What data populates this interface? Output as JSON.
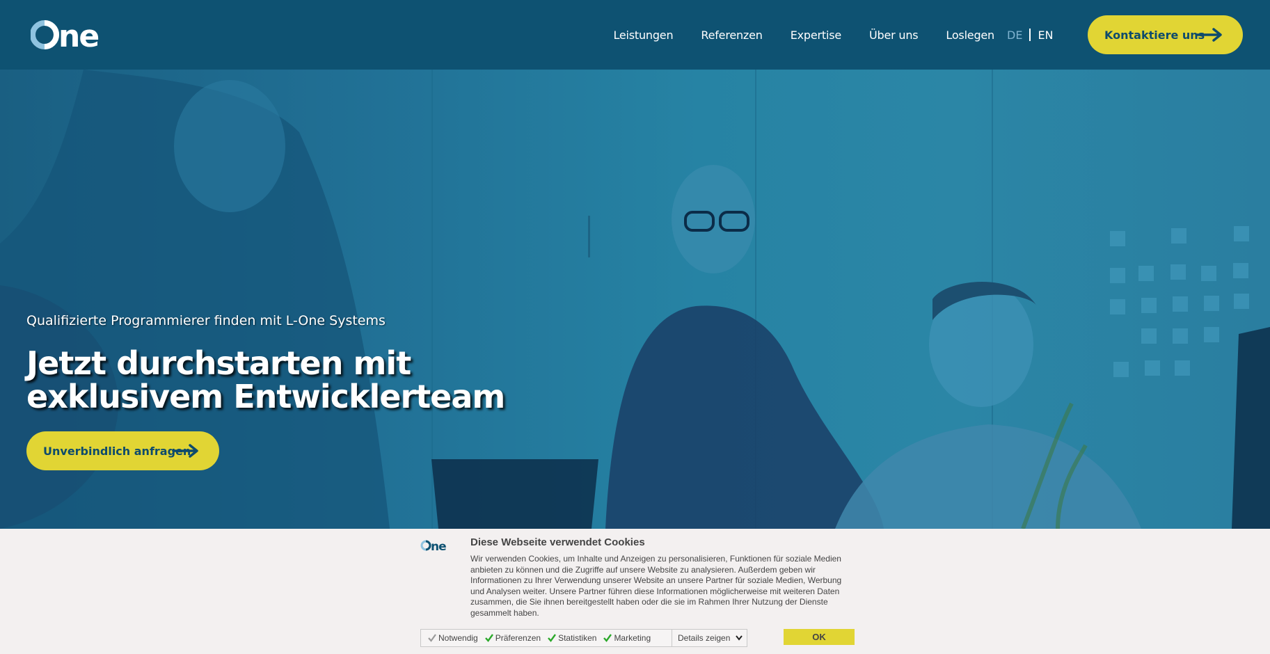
{
  "header": {
    "logo_text": "one",
    "nav": [
      "Leistungen",
      "Referenzen",
      "Expertise",
      "Über uns",
      "Loslegen"
    ],
    "lang_de": "DE",
    "lang_en": "EN",
    "contact_label": "Kontaktiere uns"
  },
  "hero": {
    "subtitle": "Qualifizierte Programmierer finden mit L-One Systems",
    "title_line1": "Jetzt durchstarten mit",
    "title_line2": "exklusivem Entwicklerteam",
    "cta_label": "Unverbindlich anfragen"
  },
  "cookie": {
    "logo_text": "one",
    "title": "Diese Webseite verwendet Cookies",
    "text": "Wir verwenden Cookies, um Inhalte und Anzeigen zu personalisieren, Funktionen für soziale Medien anbieten zu können und die Zugriffe auf unsere Website zu analysieren. Außerdem geben wir Informationen zu Ihrer Verwendung unserer Website an unsere Partner für soziale Medien, Werbung und Analysen weiter. Unsere Partner führen diese Informationen möglicherweise mit weiteren Daten zusammen, die Sie ihnen bereitgestellt haben oder die sie im Rahmen Ihrer Nutzung der Dienste gesammelt haben.",
    "options": [
      "Notwendig",
      "Präferenzen",
      "Statistiken",
      "Marketing"
    ],
    "details_label": "Details zeigen",
    "ok_label": "OK"
  },
  "colors": {
    "header_bg": "#0e5272",
    "accent_yellow": "#e1d534",
    "button_text": "#0e4b6c",
    "check_green": "#2aa82a"
  }
}
